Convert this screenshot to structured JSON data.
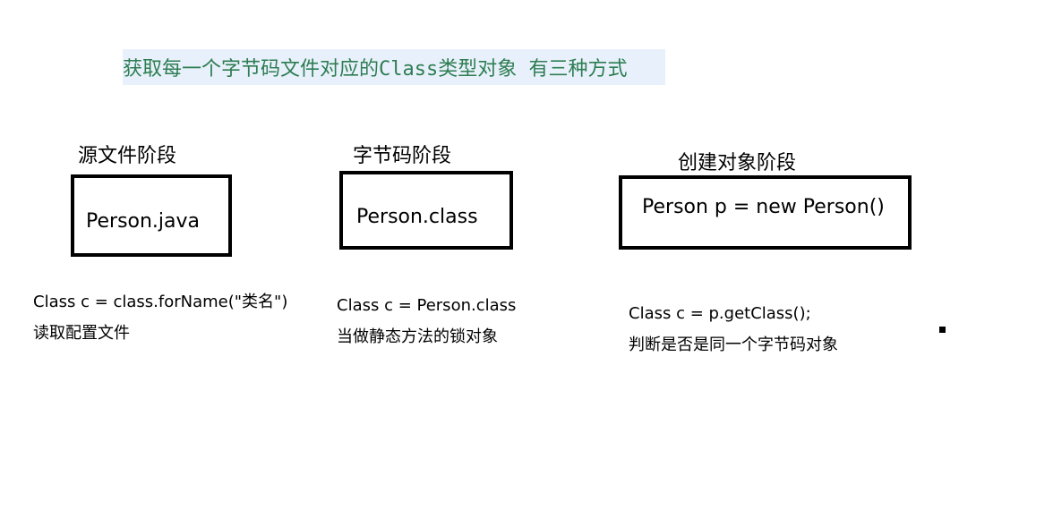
{
  "title": "获取每一个字节码文件对应的Class类型对象 有三种方式",
  "stages": [
    {
      "label": "源文件阶段",
      "box_text": "Person.java",
      "code": "Class c = class.forName(\"类名\")",
      "usage": "读取配置文件"
    },
    {
      "label": "字节码阶段",
      "box_text": "Person.class",
      "code": "Class c = Person.class",
      "usage": "当做静态方法的锁对象"
    },
    {
      "label": "创建对象阶段",
      "box_text": "Person p = new Person()",
      "code": "Class  c = p.getClass();",
      "usage": "判断是否是同一个字节码对象"
    }
  ]
}
